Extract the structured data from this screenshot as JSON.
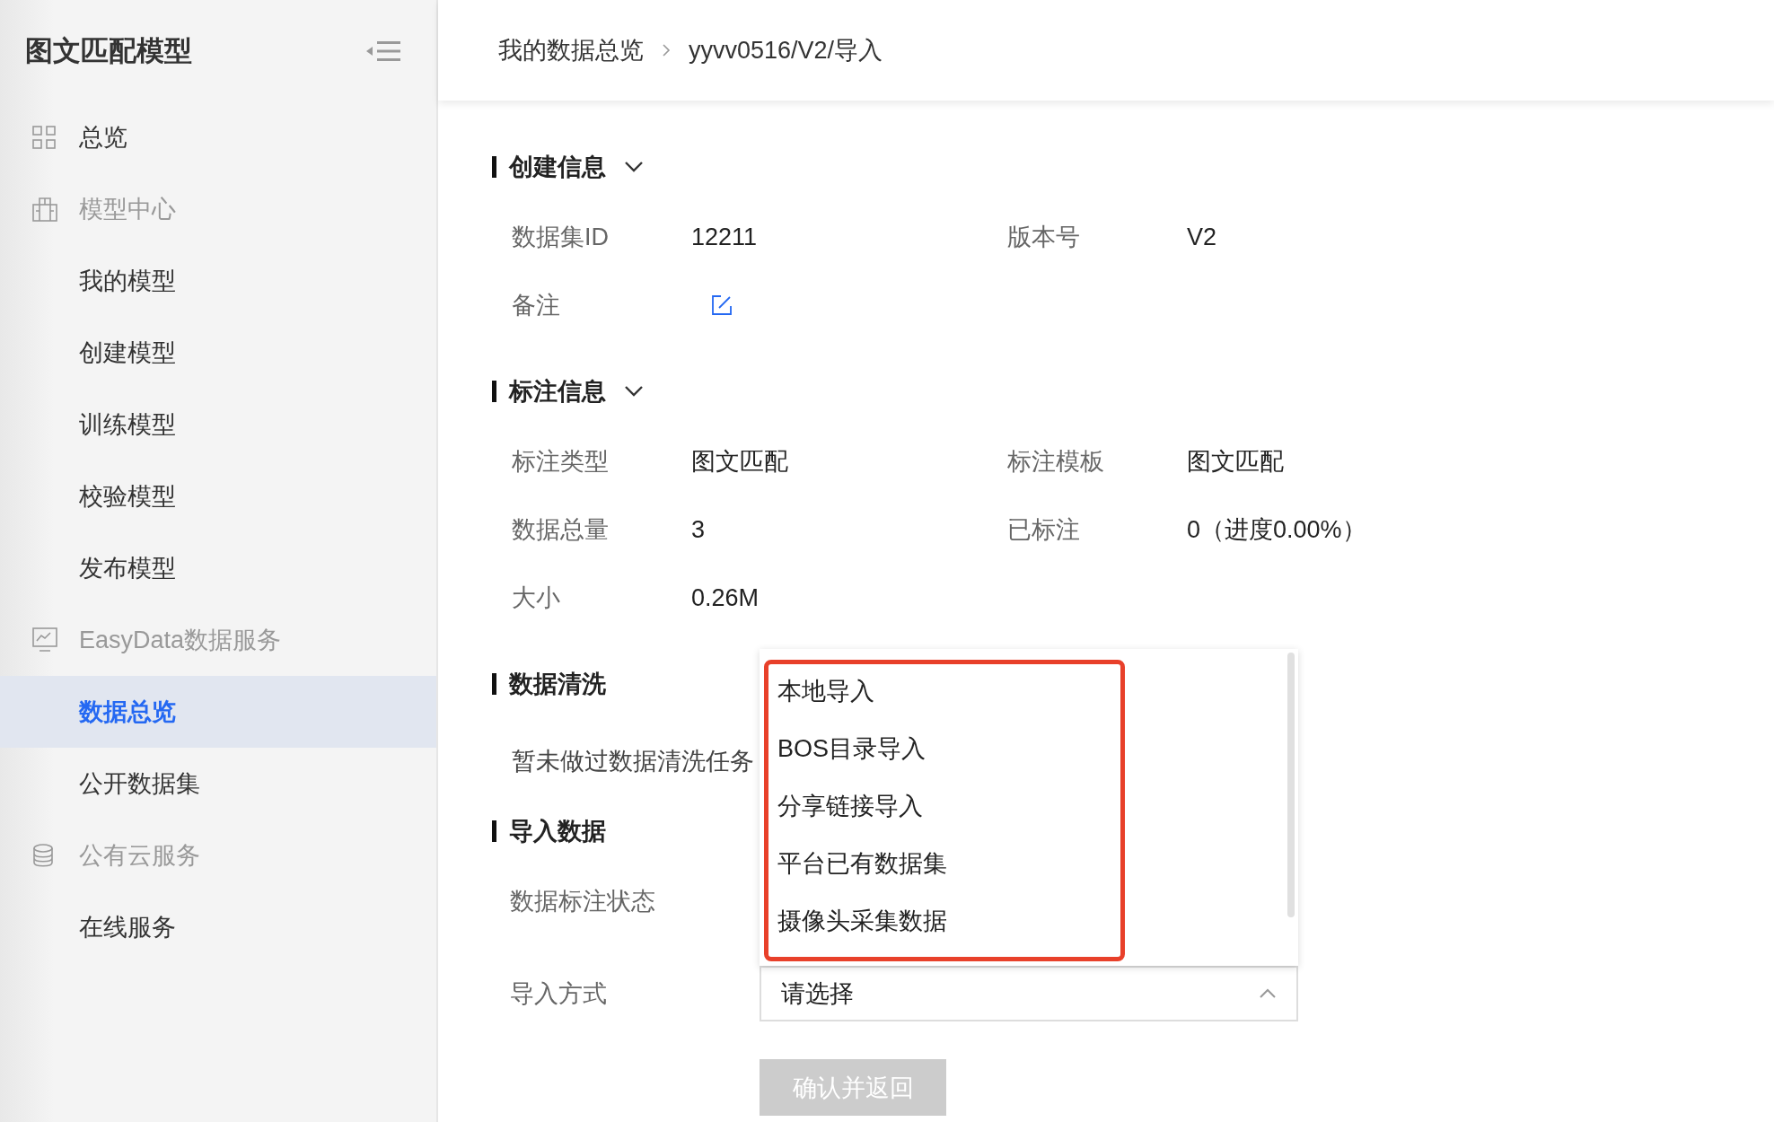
{
  "sidebar": {
    "title": "图文匹配模型",
    "items": [
      {
        "kind": "link",
        "label": "总览",
        "selected": false
      },
      {
        "kind": "group",
        "label": "模型中心",
        "selected": false,
        "children": [
          {
            "label": "我的模型",
            "selected": false
          },
          {
            "label": "创建模型",
            "selected": false
          },
          {
            "label": "训练模型",
            "selected": false
          },
          {
            "label": "校验模型",
            "selected": false
          },
          {
            "label": "发布模型",
            "selected": false
          }
        ]
      },
      {
        "kind": "group",
        "label": "EasyData数据服务",
        "selected": false,
        "children": [
          {
            "label": "数据总览",
            "selected": true
          },
          {
            "label": "公开数据集",
            "selected": false
          }
        ]
      },
      {
        "kind": "group",
        "label": "公有云服务",
        "selected": false,
        "children": [
          {
            "label": "在线服务",
            "selected": false
          }
        ]
      }
    ]
  },
  "breadcrumb": [
    "我的数据总览",
    "yyvv0516/V2/导入"
  ],
  "sections": [
    {
      "kind": "info",
      "title": "创建信息",
      "collapsible": true,
      "fields": [
        {
          "kind": "text",
          "label": "数据集ID",
          "value": "12211"
        },
        {
          "kind": "text",
          "label": "版本号",
          "value": "V2"
        },
        {
          "kind": "edit",
          "label": "备注"
        }
      ]
    },
    {
      "kind": "info",
      "title": "标注信息",
      "collapsible": true,
      "fields": [
        {
          "kind": "text",
          "label": "标注类型",
          "value": "图文匹配"
        },
        {
          "kind": "text",
          "label": "标注模板",
          "value": "图文匹配"
        },
        {
          "kind": "text",
          "label": "数据总量",
          "value": "3"
        },
        {
          "kind": "text",
          "label": "已标注",
          "value": "0（进度0.00%）"
        },
        {
          "kind": "text",
          "label": "大小",
          "value": "0.26M"
        }
      ]
    },
    {
      "kind": "note",
      "title": "数据清洗",
      "collapsible": false,
      "text": "暂未做过数据清洗任务"
    },
    {
      "kind": "import",
      "title": "导入数据",
      "collapsible": false,
      "status_label": "数据标注状态",
      "method": {
        "label": "导入方式",
        "placeholder": "请选择",
        "expanded": true,
        "highlighted": true,
        "options": [
          "本地导入",
          "BOS目录导入",
          "分享链接导入",
          "平台已有数据集",
          "摄像头采集数据"
        ]
      },
      "submit": {
        "label": "确认并返回",
        "disabled": true
      }
    }
  ]
}
